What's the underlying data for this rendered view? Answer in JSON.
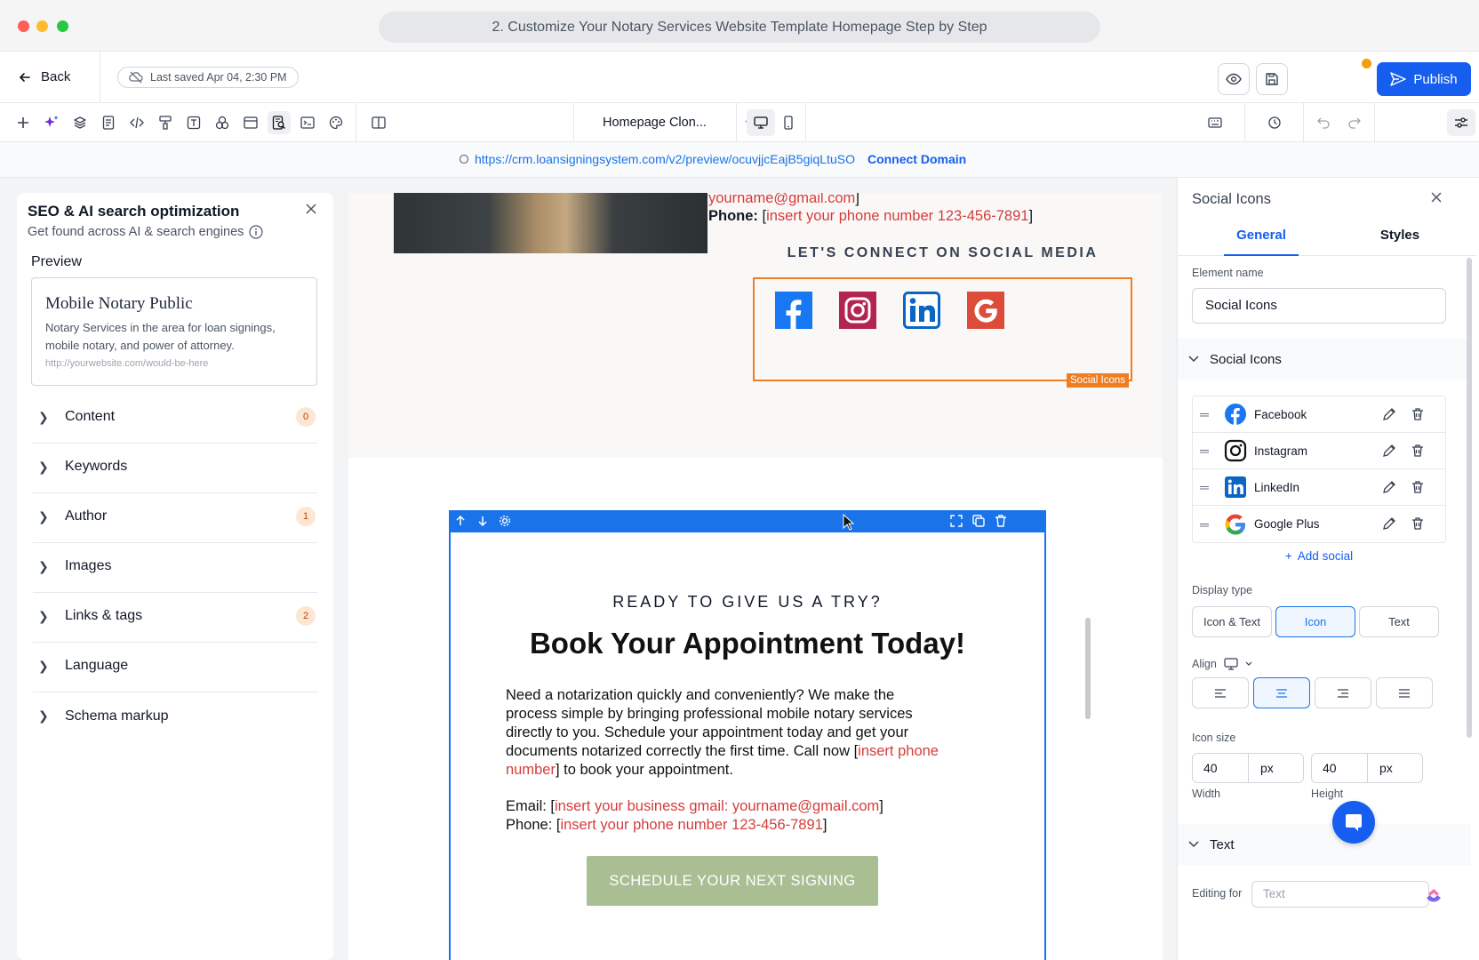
{
  "window": {
    "title": "2. Customize Your Notary Services Website Template Homepage Step by Step"
  },
  "header": {
    "back_label": "Back",
    "last_saved": "Last saved Apr 04, 2:30 PM",
    "publish_label": "Publish"
  },
  "toolbar": {
    "page_select": "Homepage Clon..."
  },
  "url_bar": {
    "url": "https://crm.loansigningsystem.com/v2/preview/ocuvjjcEajB5giqLtuSO",
    "connect_label": "Connect Domain"
  },
  "seo_panel": {
    "title": "SEO & AI search optimization",
    "subtitle": "Get found across AI & search engines",
    "preview_label": "Preview",
    "preview_card": {
      "title": "Mobile Notary Public",
      "description": "Notary Services in the area for loan signings, mobile notary, and power of attorney.",
      "url": "http://yourwebsite.com/would-be-here"
    },
    "sections": [
      {
        "label": "Content",
        "badge": "0"
      },
      {
        "label": "Keywords",
        "badge": ""
      },
      {
        "label": "Author",
        "badge": "1"
      },
      {
        "label": "Images",
        "badge": ""
      },
      {
        "label": "Links & tags",
        "badge": "2"
      },
      {
        "label": "Language",
        "badge": ""
      },
      {
        "label": "Schema markup",
        "badge": ""
      }
    ]
  },
  "canvas": {
    "email_line": "yourname@gmail.com",
    "phone_prefix": "Phone:",
    "phone_text": "insert your phone number 123-456-7891",
    "social_heading": "LET'S CONNECT ON SOCIAL MEDIA",
    "social_tag": "Social Icons",
    "cta": {
      "eyebrow": "READY TO GIVE US A TRY?",
      "heading": "Book Your Appointment Today!",
      "body_part1": "Need a notarization quickly and conveniently? We make the process simple by bringing professional mobile notary services directly to you. Schedule your appointment today and get your documents notarized correctly the first time. Call now [",
      "body_red": "insert phone number",
      "body_part2": "] to book your appointment.",
      "email_prefix": "Email: [",
      "email_red": "insert your business gmail: yourname@gmail.com",
      "phone_prefix": "Phone: [",
      "phone_red": "insert your phone number 123-456-7891",
      "button_label": "SCHEDULE YOUR NEXT SIGNING"
    }
  },
  "right_panel": {
    "title": "Social Icons",
    "tabs": [
      "General",
      "Styles"
    ],
    "element_name_label": "Element name",
    "element_name_value": "Social Icons",
    "section_social": "Social Icons",
    "social_items": [
      "Facebook",
      "Instagram",
      "LinkedIn",
      "Google Plus"
    ],
    "add_social": "Add social",
    "display_type_label": "Display type",
    "display_types": [
      "Icon & Text",
      "Icon",
      "Text"
    ],
    "align_label": "Align",
    "icon_size_label": "Icon size",
    "width_value": "40",
    "height_value": "40",
    "unit": "px",
    "width_label": "Width",
    "height_label": "Height",
    "section_text": "Text",
    "editing_for_label": "Editing for",
    "editing_for_placeholder": "Text"
  },
  "colors": {
    "accent": "#155eef",
    "selection_blue": "#1a73e8",
    "selection_orange": "#ef7d22",
    "placeholder_red": "#d63c3c",
    "cta_button": "#a9bf93"
  }
}
